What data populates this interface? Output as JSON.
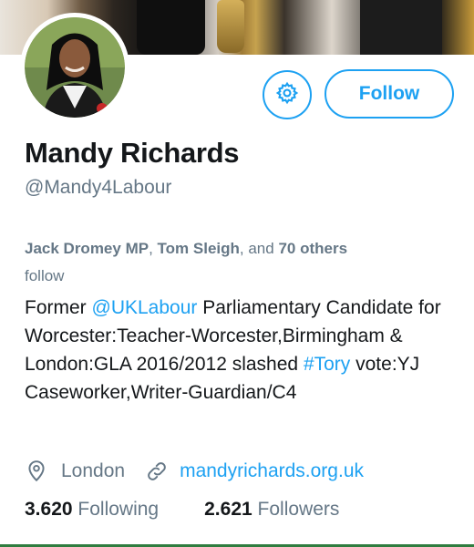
{
  "profile": {
    "name": "Mandy Richards",
    "handle": "@Mandy4Labour",
    "follow_label": "Follow",
    "settings_icon": "gear-icon"
  },
  "followed_by": {
    "names": [
      "Jack Dromey MP",
      "Tom Sleigh"
    ],
    "sep": ", ",
    "and_text": ", and ",
    "others": "70 others",
    "suffix": "follow"
  },
  "bio": {
    "seg1": "Former ",
    "mention": "@UKLabour",
    "seg2": " Parliamentary Candidate for Worcester:Teacher-Worcester,Birmingham & London:GLA 2016/2012 slashed ",
    "hashtag": "#Tory",
    "seg3": " vote:YJ Caseworker,Writer-Guardian/C4"
  },
  "meta": {
    "location": "London",
    "location_icon": "location-pin-icon",
    "website": "mandyrichards.org.uk",
    "link_icon": "link-icon"
  },
  "stats": {
    "following_count": "3.620",
    "following_label": "Following",
    "followers_count": "2.621",
    "followers_label": "Followers"
  },
  "colors": {
    "accent": "#1da1f2",
    "secondary_text": "#657786",
    "primary_text": "#14171a"
  }
}
